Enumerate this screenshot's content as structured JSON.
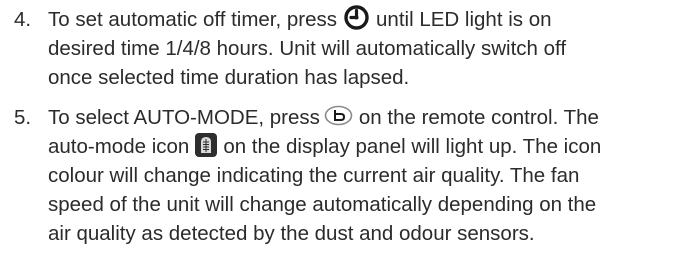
{
  "steps": [
    {
      "number": "4.",
      "line1_a": "To set automatic off timer, press",
      "line1_b": "until LED light is on",
      "line2": "desired time 1/4/8 hours. Unit will automatically switch off",
      "line3": "once selected time duration has lapsed.",
      "icon": "timer-button-icon"
    },
    {
      "number": "5.",
      "line1_a": "To select AUTO-MODE, press",
      "line1_b": "on the remote control. The",
      "line2_a": "auto-mode icon",
      "line2_b": "on the display panel will light up. The icon",
      "line3": "colour will change indicating the current air quality. The fan",
      "line4": "speed of the unit will change automatically depending on the",
      "line5": "air quality as detected by the dust and odour sensors.",
      "icons": [
        "auto-mode-button-icon",
        "auto-mode-display-icon"
      ]
    }
  ]
}
